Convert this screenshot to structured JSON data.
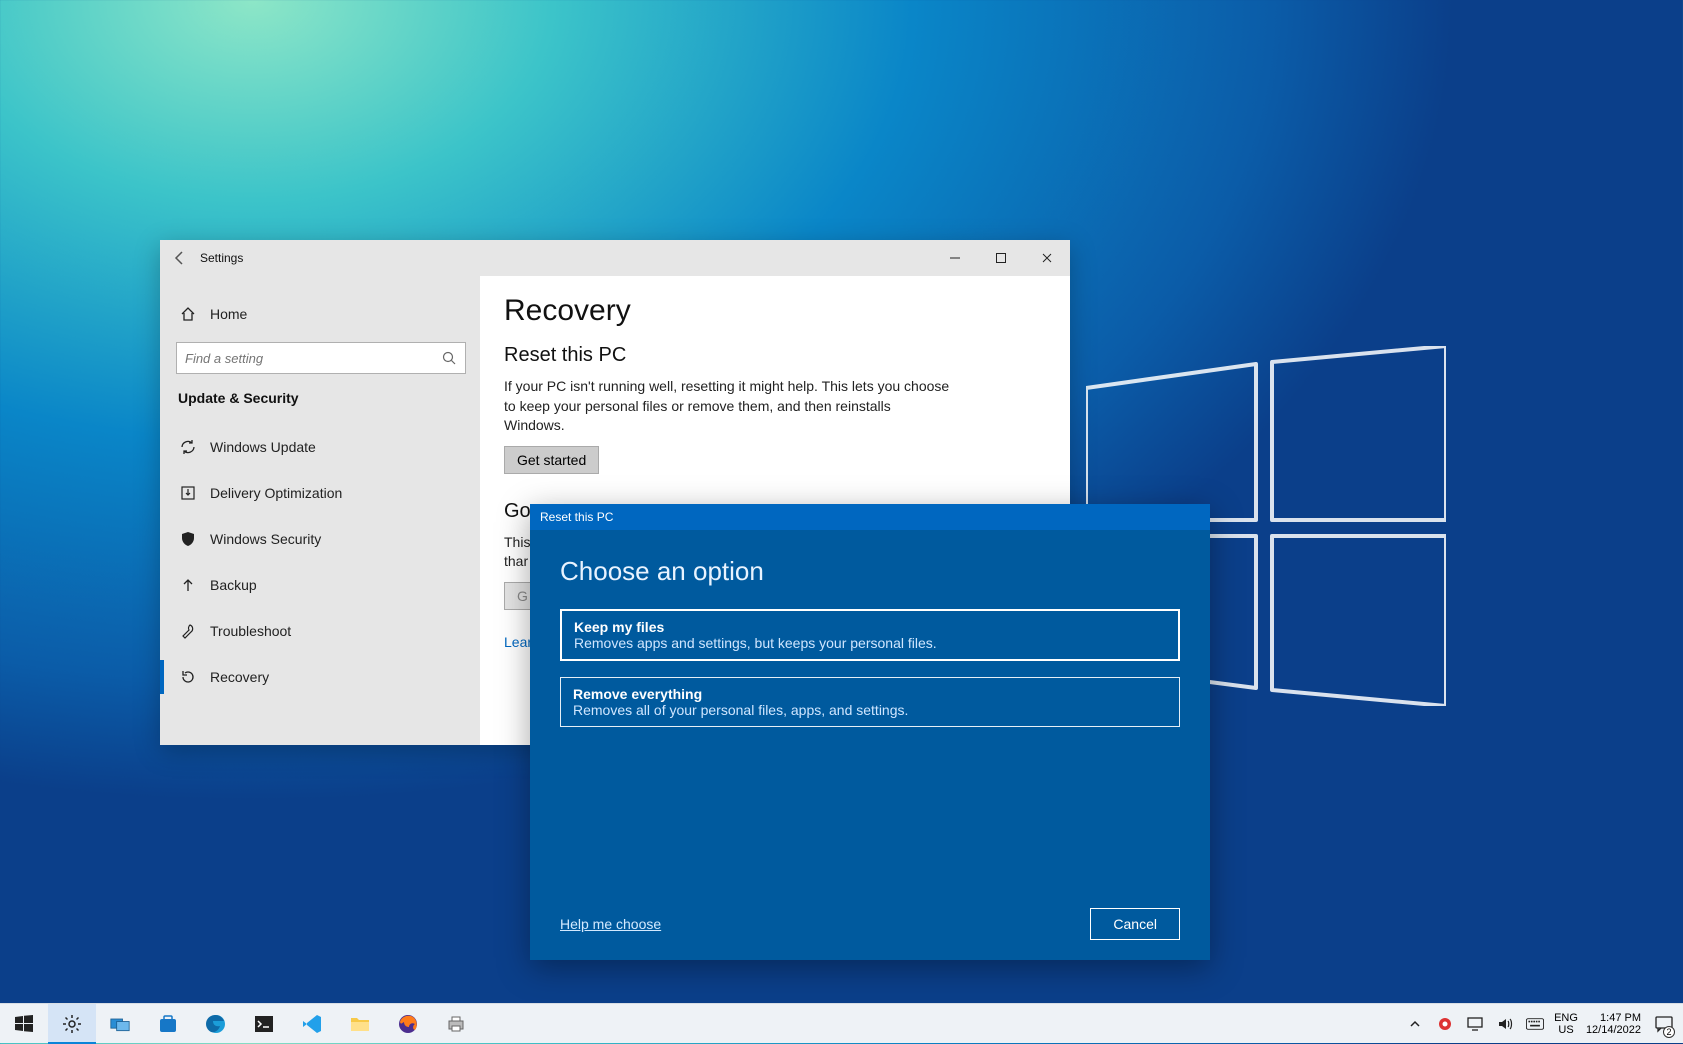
{
  "settingsWindow": {
    "titlebarLabel": "Settings",
    "sidebar": {
      "home": "Home",
      "searchPlaceholder": "Find a setting",
      "section": "Update & Security",
      "items": [
        {
          "label": "Windows Update"
        },
        {
          "label": "Delivery Optimization"
        },
        {
          "label": "Windows Security"
        },
        {
          "label": "Backup"
        },
        {
          "label": "Troubleshoot"
        },
        {
          "label": "Recovery"
        }
      ]
    },
    "page": {
      "title": "Recovery",
      "resetHeader": "Reset this PC",
      "resetBody": "If your PC isn't running well, resetting it might help. This lets you choose to keep your personal files or remove them, and then reinstalls Windows.",
      "getStarted": "Get started",
      "goBackHeader": "Go",
      "goBackBody": "This thar",
      "learnLink": "Lear"
    }
  },
  "resetDialog": {
    "titlebar": "Reset this PC",
    "heading": "Choose an option",
    "options": [
      {
        "title": "Keep my files",
        "desc": "Removes apps and settings, but keeps your personal files."
      },
      {
        "title": "Remove everything",
        "desc": "Removes all of your personal files, apps, and settings."
      }
    ],
    "helpLink": "Help me choose",
    "cancel": "Cancel"
  },
  "taskbar": {
    "lang1": "ENG",
    "lang2": "US",
    "time": "1:47 PM",
    "date": "12/14/2022",
    "notifCount": "2"
  }
}
